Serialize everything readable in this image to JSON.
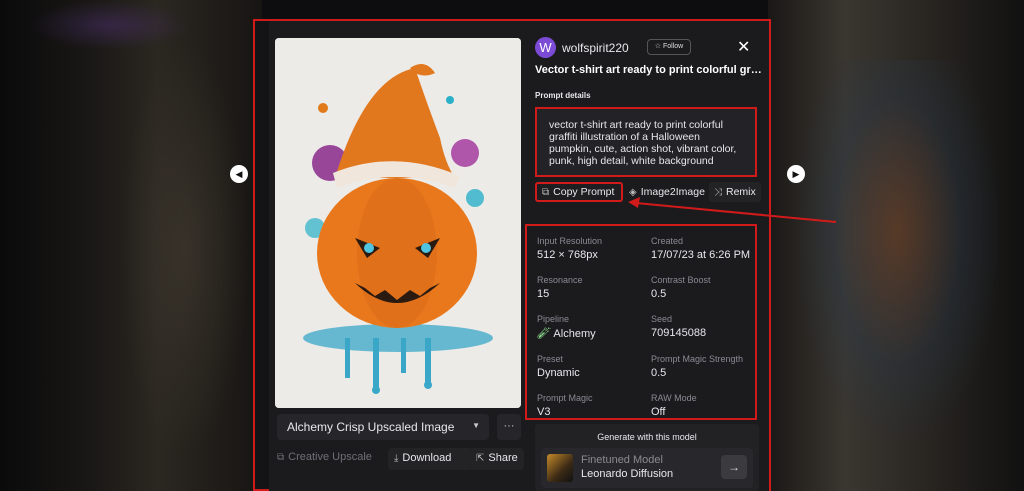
{
  "user": {
    "avatar_letter": "W",
    "username": "wolfspirit220",
    "follow_label": "Follow"
  },
  "image": {
    "title": "Vector t-shirt art ready to print colorful graffiti illustration of a Halloween pumpkin, cute, action shot, vibrant color, punk, high detail, white background"
  },
  "prompt": {
    "label": "Prompt details",
    "text": "vector t-shirt art ready to print colorful graffiti illustration of a Halloween pumpkin, cute, action shot, vibrant color, punk, high detail, white background"
  },
  "actions": {
    "copy_prompt": "Copy Prompt",
    "image2image": "Image2Image",
    "remix": "Remix"
  },
  "details": [
    {
      "key": "Input Resolution",
      "value": "512 × 768px"
    },
    {
      "key": "Created",
      "value": "17/07/23 at 6:26 PM"
    },
    {
      "key": "Resonance",
      "value": "15"
    },
    {
      "key": "Contrast Boost",
      "value": "0.5"
    },
    {
      "key": "Pipeline",
      "value": "Alchemy"
    },
    {
      "key": "Seed",
      "value": "709145088"
    },
    {
      "key": "Preset",
      "value": "Dynamic"
    },
    {
      "key": "Prompt Magic Strength",
      "value": "0.5"
    },
    {
      "key": "Prompt Magic",
      "value": "V3"
    },
    {
      "key": "RAW Mode",
      "value": "Off"
    }
  ],
  "left_controls": {
    "model_select": "Alchemy Crisp Upscaled Image",
    "more": "···",
    "creative_upscale": "Creative Upscale",
    "download": "Download",
    "share": "Share"
  },
  "generate": {
    "title": "Generate with this model",
    "model_kind": "Finetuned Model",
    "model_name": "Leonardo Diffusion"
  },
  "colors": {
    "annotation_red": "#d11a1a",
    "avatar_purple": "#7b4bd6",
    "panel_bg": "#1b1b1e"
  }
}
